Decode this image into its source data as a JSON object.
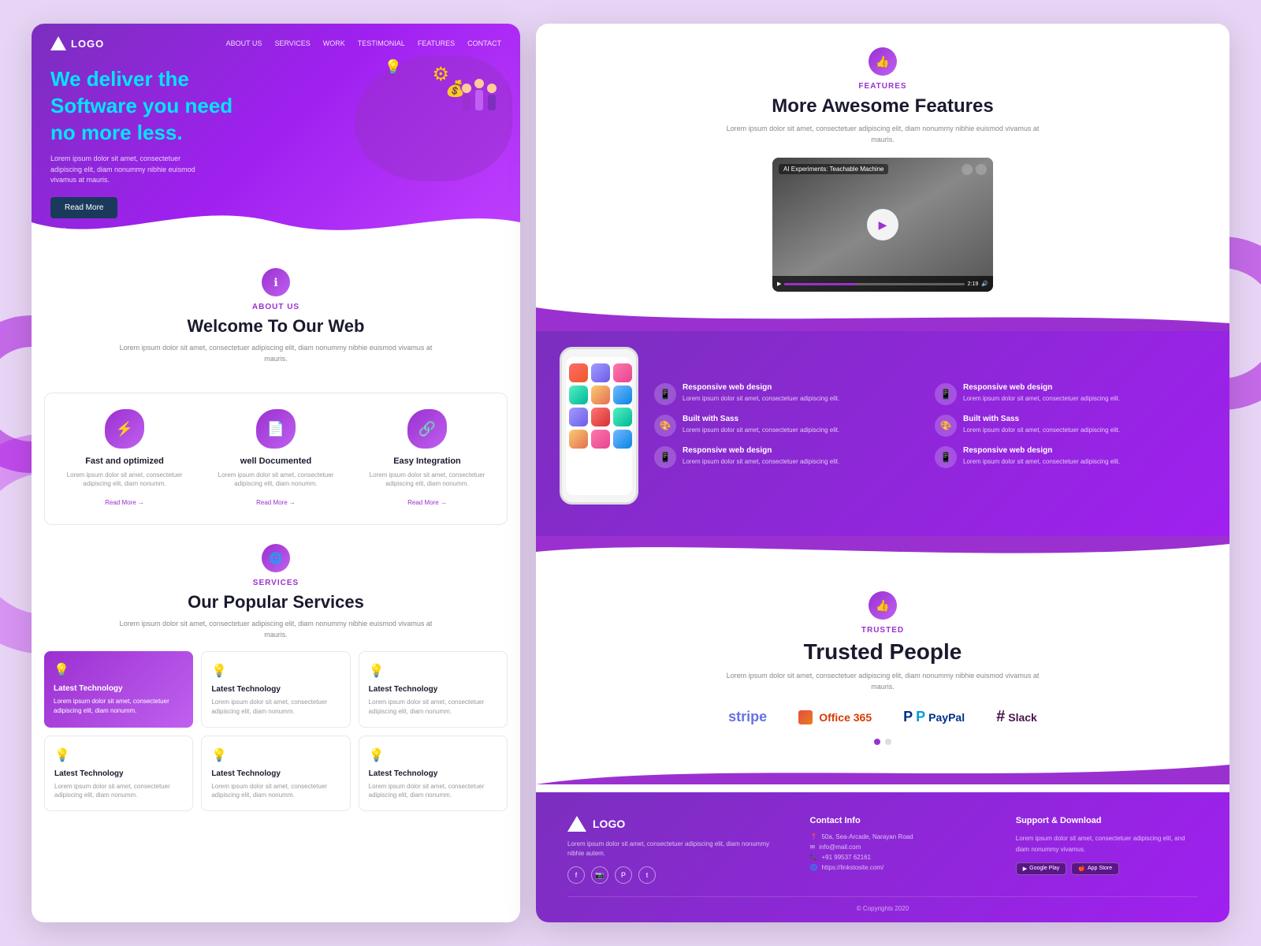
{
  "background": {
    "color": "#e0b8f0"
  },
  "left_panel": {
    "nav": {
      "logo": "LOGO",
      "links": [
        "ABOUT US",
        "SERVICES",
        "WORK",
        "TESTIMONIAL",
        "FEATURES",
        "CONTACT"
      ]
    },
    "hero": {
      "line1": "We deliver the",
      "highlight": "Software",
      "line2": "you need",
      "line3": "no more less.",
      "description": "Lorem ipsum dolor sit amet, consectetuer adipiscing elit, diam nonummy nibhie euismod vivamus at mauris.",
      "button": "Read More",
      "dot1": "active",
      "dot2": "inactive"
    },
    "about": {
      "label": "ABOUT US",
      "title": "Welcome To Our Web",
      "description": "Lorem ipsum dolor sit amet, consectetuer adipiscing elit, diam nonummy nibhie euismod vivamus at mauris.",
      "icon": "ℹ"
    },
    "features": [
      {
        "title": "Fast and optimized",
        "description": "Lorem ipsum dolor sit amet, consectetuer adipiscing elit, diam nonumm.",
        "link": "Read More →"
      },
      {
        "title": "well Documented",
        "description": "Lorem ipsum dolor sit amet, consectetuer adipiscing elit, diam nonumm.",
        "link": "Read More →"
      },
      {
        "title": "Easy Integration",
        "description": "Lorem ipsum dolor sit amet, consectetuer adipiscing elit, diam nonumm.",
        "link": "Read More →"
      }
    ],
    "services": {
      "label": "SERVICES",
      "title": "Our Popular Services",
      "description": "Lorem ipsum dolor sit amet, consectetuer adipiscing elit, diam nonummy nibhie euismod vivamus at mauris.",
      "icon": "🌐"
    },
    "service_cards": [
      {
        "title": "Latest Technology",
        "description": "Lorem ipsum dolor sit amet, consectetuer adipiscing elit, diam nonumm.",
        "featured": true
      },
      {
        "title": "Latest Technology",
        "description": "Lorem ipsum dolor sit amet, consectetuer adipiscing elit, diam nonumm.",
        "featured": false
      },
      {
        "title": "Latest Technology",
        "description": "Lorem ipsum dolor sit amet, consectetuer adipiscing elit, diam nonumm.",
        "featured": false
      },
      {
        "title": "Latest Technology",
        "description": "Lorem ipsum dolor sit amet, consectetuer adipiscing elit, diam nonumm.",
        "featured": false
      },
      {
        "title": "Latest Technology",
        "description": "Lorem ipsum dolor sit amet, consectetuer adipiscing elit, diam nonumm.",
        "featured": false
      },
      {
        "title": "Latest Technology",
        "description": "Lorem ipsum dolor sit amet, consectetuer adipiscing elit, diam nonumm.",
        "featured": false
      }
    ]
  },
  "right_panel": {
    "features_section": {
      "label": "FEATURES",
      "title": "More Awesome Features",
      "description": "Lorem ipsum dolor sit amet, consectetuer adipiscing elit, diam nonummy nibhie euismod vivamus at mauris.",
      "icon": "👍",
      "video": {
        "title": "AI Experiments: Teachable Machine",
        "time": "2:19"
      }
    },
    "feature_items": [
      {
        "title": "Responsive web design",
        "description": "Lorem ipsum dolor sit amet, consectetuer adipiscing elit."
      },
      {
        "title": "Responsive web design",
        "description": "Lorem ipsum dolor sit amet, consectetuer adipiscing elit."
      },
      {
        "title": "Built with Sass",
        "description": "Lorem ipsum dolor sit amet, consectetuer adipiscing elit."
      },
      {
        "title": "Built with Sass",
        "description": "Lorem ipsum dolor sit amet, consectetuer adipiscing elit."
      },
      {
        "title": "Responsive web design",
        "description": "Lorem ipsum dolor sit amet, consectetuer adipiscing elit."
      },
      {
        "title": "Responsive web design",
        "description": "Lorem ipsum dolor sit amet, consectetuer adipiscing elit."
      }
    ],
    "trusted": {
      "label": "TRUSTED",
      "title": "Trusted People",
      "description": "Lorem ipsum dolor sit amet, consectetuer adipiscing elit, diam nonummy nibhie euismod vivamus at mauris.",
      "icon": "👍",
      "logos": [
        "stripe",
        "Office 365",
        "PayPal",
        "Slack"
      ]
    },
    "footer": {
      "logo": "LOGO",
      "description": "Lorem ipsum dolor sit amet, consectetuer adipiscing elit, diam nonummy nibhie autem.",
      "contact_label": "Contact Info",
      "contact": {
        "address": "50a, Sea-Arcade, Narayan Road",
        "email": "info@mail.com",
        "phone": "+91 99537 62161",
        "website": "https://linkstosite.com/"
      },
      "support_label": "Support & Download",
      "support_desc": "Lorem ipsum dolor sit amet, consectetuer adipiscing elit, and diam nonummy vivamus.",
      "google_play": "Google Play",
      "app_store": "App Store",
      "copyright": "© Copyrights 2020"
    }
  }
}
